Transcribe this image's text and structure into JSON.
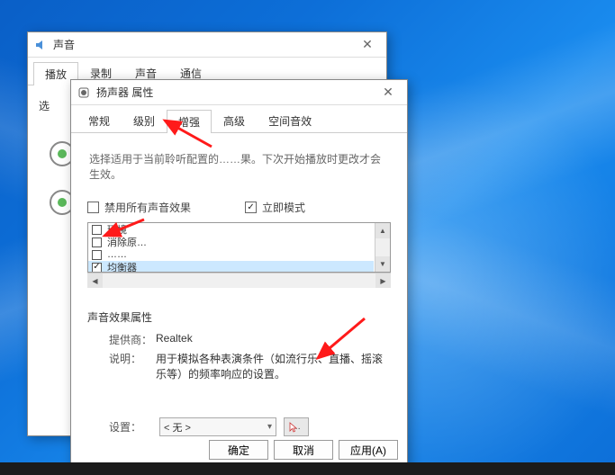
{
  "sound_dialog": {
    "title": "声音",
    "tabs": [
      "播放",
      "录制",
      "声音",
      "通信"
    ],
    "active_tab": 0,
    "select_label": "选"
  },
  "speaker_dialog": {
    "title": "扬声器 属性",
    "tabs": [
      "常规",
      "级别",
      "增强",
      "高级",
      "空间音效"
    ],
    "active_tab": 2,
    "description": "选择适用于当前聆听配置的……果。下次开始播放时更改才会生效。",
    "disable_all_label": "禁用所有声音效果",
    "instant_mode_label": "立即模式",
    "effects": [
      {
        "label": "环境",
        "checked": false
      },
      {
        "label": "消除原…",
        "checked": false
      },
      {
        "label": "……",
        "checked": false
      },
      {
        "label": "均衡器",
        "checked": true
      }
    ],
    "props": {
      "group_title": "声音效果属性",
      "provider_label": "提供商：",
      "provider_value": "Realtek",
      "desc_label": "说明：",
      "desc_value": "用于模拟各种表演条件（如流行乐、直播、摇滚乐等）的频率响应的设置。"
    },
    "settings": {
      "label": "设置：",
      "selected": "< 无 >"
    },
    "buttons": {
      "ok": "确定",
      "cancel": "取消",
      "apply": "应用(A)"
    }
  },
  "colors": {
    "arrow": "#ff1a1a"
  }
}
